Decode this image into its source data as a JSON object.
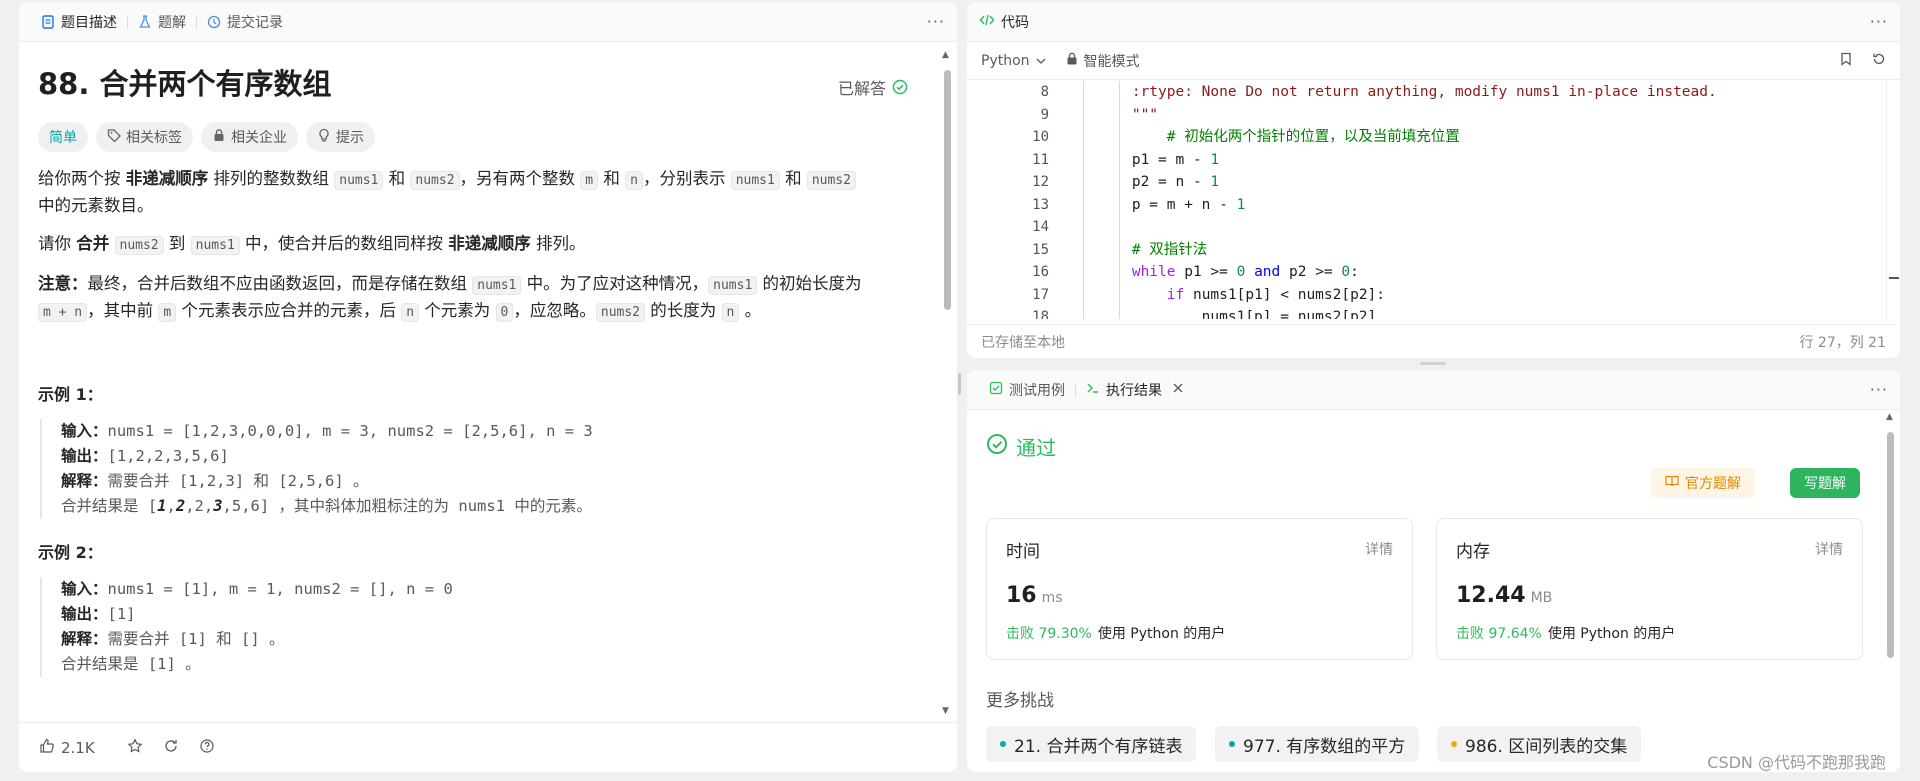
{
  "left": {
    "tabs": [
      {
        "label": "题目描述",
        "icon": "doc-icon"
      },
      {
        "label": "题解",
        "icon": "flask-icon"
      },
      {
        "label": "提交记录",
        "icon": "history-icon"
      }
    ],
    "title": "88. 合并两个有序数组",
    "solved": "已解答",
    "tags": [
      "简单",
      "相关标签",
      "相关企业",
      "提示"
    ],
    "desc1": [
      "给你两个按 ",
      "非递减顺序",
      " 排列的整数数组 ",
      "nums1",
      " 和 ",
      "nums2",
      "，另有两个整数 ",
      "m",
      " 和 ",
      "n",
      "，分别表示 ",
      "nums1",
      " 和 ",
      "nums2"
    ],
    "desc1b": "中的元素数目。",
    "desc2": [
      "请你 ",
      "合并",
      " ",
      "nums2",
      " 到 ",
      "nums1",
      " 中，使合并后的数组同样按 ",
      "非递减顺序",
      " 排列。"
    ],
    "note": [
      "注意：",
      "最终，合并后数组不应由函数返回，而是存储在数组 ",
      "nums1",
      " 中。为了应对这种情况，",
      "nums1",
      " 的初始长度为"
    ],
    "note2": [
      "m + n",
      "，其中前 ",
      "m",
      " 个元素表示应合并的元素，后 ",
      "n",
      " 个元素为 ",
      "0",
      "，应忽略。",
      "nums2",
      " 的长度为 ",
      "n",
      " 。"
    ],
    "ex1_title": "示例 1：",
    "ex1": {
      "input_label": "输入：",
      "input": "nums1 = [1,2,3,0,0,0], m = 3, nums2 = [2,5,6], n = 3",
      "output_label": "输出：",
      "output": "[1,2,2,3,5,6]",
      "explain_label": "解释：",
      "explain": "需要合并 [1,2,3] 和 [2,5,6] 。",
      "merge_pre": "合并结果是 [",
      "merge_b1": "1",
      "merge_s1": ",",
      "merge_b2": "2",
      "merge_s2": ",2,",
      "merge_b3": "3",
      "merge_s3": ",5,6] ，其中斜体加粗标注的为 nums1 中的元素。"
    },
    "ex2_title": "示例 2：",
    "ex2": {
      "input_label": "输入：",
      "input": "nums1 = [1], m = 1, nums2 = [], n = 0",
      "output_label": "输出：",
      "output": "[1]",
      "explain_label": "解释：",
      "explain": "需要合并 [1] 和 [] 。",
      "merge": "合并结果是 [1] 。"
    },
    "likes": "2.1K"
  },
  "code": {
    "tab": "代码",
    "lang": "Python",
    "mode": "智能模式",
    "line_numbers": [
      "8",
      "9",
      "10",
      "11",
      "12",
      "13",
      "14",
      "15",
      "16",
      "17",
      "18"
    ],
    "status": "已存储至本地",
    "cursor": "行 27，列 21"
  },
  "result": {
    "tabs": [
      "测试用例",
      "执行结果"
    ],
    "pass": "通过",
    "official": "官方题解",
    "write": "写题解",
    "time_label": "时间",
    "time_detail": "详情",
    "time_value": "16",
    "time_unit": "ms",
    "time_beat": "击败 79.30%",
    "time_tail": "使用 Python 的用户",
    "mem_label": "内存",
    "mem_detail": "详情",
    "mem_value": "12.44",
    "mem_unit": "MB",
    "mem_beat": "击败 97.64%",
    "mem_tail": "使用 Python 的用户",
    "more": "更多挑战",
    "chips": [
      {
        "label": "21. 合并两个有序链表",
        "color": "#00a8a8"
      },
      {
        "label": "977. 有序数组的平方",
        "color": "#00a8a8"
      },
      {
        "label": "986. 区间列表的交集",
        "color": "#f0a800"
      }
    ]
  },
  "watermark": "CSDN @代码不跑那我跑"
}
